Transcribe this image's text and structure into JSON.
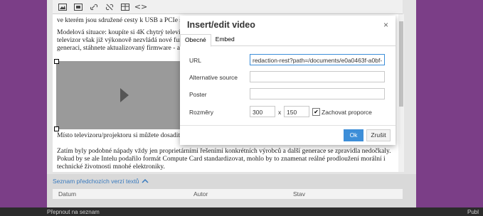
{
  "toolbar": {
    "icons": [
      "image-icon",
      "media-icon",
      "link-icon",
      "unlink-icon",
      "table-icon",
      "code-icon"
    ],
    "code_symbol": "<>"
  },
  "content": {
    "p1": "ve kterém jsou sdružené cesty k USB a PCIe s",
    "p2a": "Modelová situace: koupíte si 4K chytrý televiz",
    "p2b": "televizor však již výkonově nezvládá nové fun",
    "p2c": "generaci, stáhnete aktualizovaný firmware - a",
    "p3": "Místo televizoru/projektoru si můžete dosadit",
    "p4a": "Zatím byly podobné nápady vždy jen proprietárními řešeními konkrétních výrobců a další generace se zpravidla nedočkaly.",
    "p4b": "Pokud by se ale Intelu podařilo formát Compute Card standardizovat, mohlo by to znamenat reálné prodloužení morální i",
    "p4c": "technické životnosti mnohé elektroniky."
  },
  "versions": {
    "link": "Seznam předchozích verzí textů",
    "columns": [
      "Datum",
      "Autor",
      "Stav"
    ]
  },
  "footer": {
    "left": "Přepnout na seznam",
    "right": "Publ"
  },
  "dialog": {
    "title": "Insert/edit video",
    "close": "×",
    "tabs": [
      "Obecné",
      "Embed"
    ],
    "url_label": "URL",
    "url_value": "redaction-rest?path=/documents/e0a0463f-a0bf-",
    "alt_label": "Alternative source",
    "poster_label": "Poster",
    "dims_label": "Rozměry",
    "width": "300",
    "x": "x",
    "height": "150",
    "keep_ratio_label": "Zachovat proporce",
    "keep_ratio_checked": "✔",
    "ok": "Ok",
    "cancel": "Zrušit"
  },
  "colors": {
    "accent": "#3d8ed8",
    "sidebar": "#7b3e87",
    "link": "#3a7bbf"
  }
}
